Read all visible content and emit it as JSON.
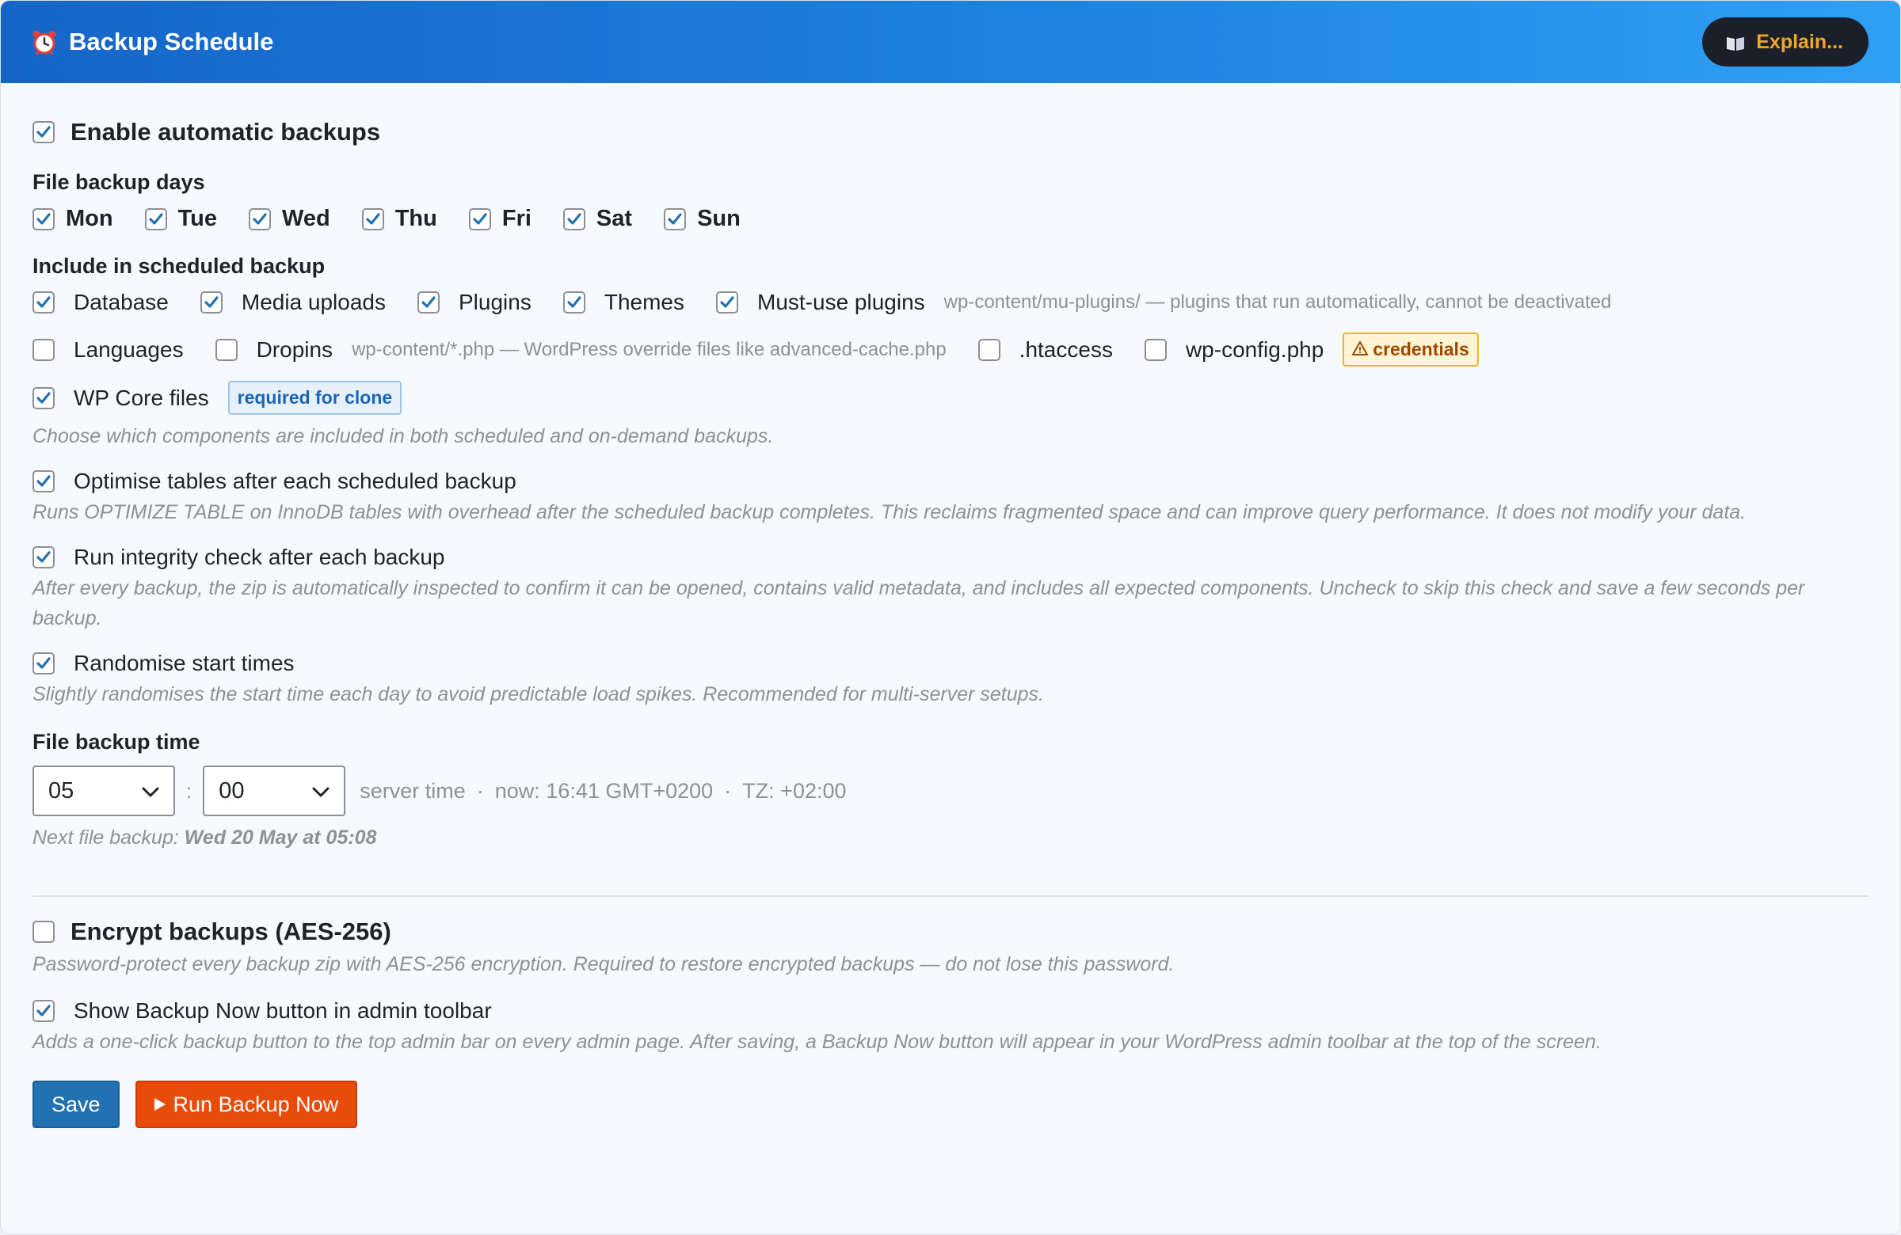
{
  "header": {
    "title": "Backup Schedule",
    "explain_label": "Explain..."
  },
  "enable": {
    "label": "Enable automatic backups",
    "checked": true
  },
  "days": {
    "label": "File backup days",
    "items": [
      {
        "label": "Mon",
        "checked": true
      },
      {
        "label": "Tue",
        "checked": true
      },
      {
        "label": "Wed",
        "checked": true
      },
      {
        "label": "Thu",
        "checked": true
      },
      {
        "label": "Fri",
        "checked": true
      },
      {
        "label": "Sat",
        "checked": true
      },
      {
        "label": "Sun",
        "checked": true
      }
    ]
  },
  "include": {
    "label": "Include in scheduled backup",
    "database": "Database",
    "media": "Media uploads",
    "plugins": "Plugins",
    "themes": "Themes",
    "mu_plugins": "Must-use plugins",
    "mu_hint": "wp-content/mu-plugins/ — plugins that run automatically, cannot be deactivated",
    "languages": "Languages",
    "dropins": "Dropins",
    "dropins_hint": "wp-content/*.php — WordPress override files like advanced-cache.php",
    "htaccess": ".htaccess",
    "wpconfig": "wp-config.php",
    "credentials_badge": "credentials",
    "core": "WP Core files",
    "core_badge": "required for clone",
    "description": "Choose which components are included in both scheduled and on-demand backups."
  },
  "optimise": {
    "label": "Optimise tables after each scheduled backup",
    "description": "Runs OPTIMIZE TABLE on InnoDB tables with overhead after the scheduled backup completes. This reclaims fragmented space and can improve query performance. It does not modify your data."
  },
  "integrity": {
    "label": "Run integrity check after each backup",
    "description": "After every backup, the zip is automatically inspected to confirm it can be opened, contains valid metadata, and includes all expected components. Uncheck to skip this check and save a few seconds per backup."
  },
  "randomise": {
    "label": "Randomise start times",
    "description": "Slightly randomises the start time each day to avoid predictable load spikes. Recommended for multi-server setups."
  },
  "time": {
    "label": "File backup time",
    "hour": "05",
    "minute": "00",
    "separator": ":",
    "server_time": "server time",
    "dot": "·",
    "now": "now: 16:41 GMT+0200",
    "tz": "TZ: +02:00",
    "next_prefix": "Next file backup:",
    "next_value": "Wed 20 May at 05:08"
  },
  "encrypt": {
    "label": "Encrypt backups (AES-256)",
    "description": "Password-protect every backup zip with AES-256 encryption. Required to restore encrypted backups — do not lose this password."
  },
  "toolbar": {
    "label": "Show Backup Now button in admin toolbar",
    "description": "Adds a one-click backup button to the top admin bar on every admin page. After saving, a Backup Now button will appear in your WordPress admin toolbar at the top of the screen."
  },
  "actions": {
    "save": "Save",
    "run": "Run Backup Now"
  },
  "colors": {
    "header_start": "#1565c8",
    "header_end": "#2fa0f5",
    "primary": "#2271b1",
    "run": "#e84c0b",
    "check": "#2271b1"
  }
}
